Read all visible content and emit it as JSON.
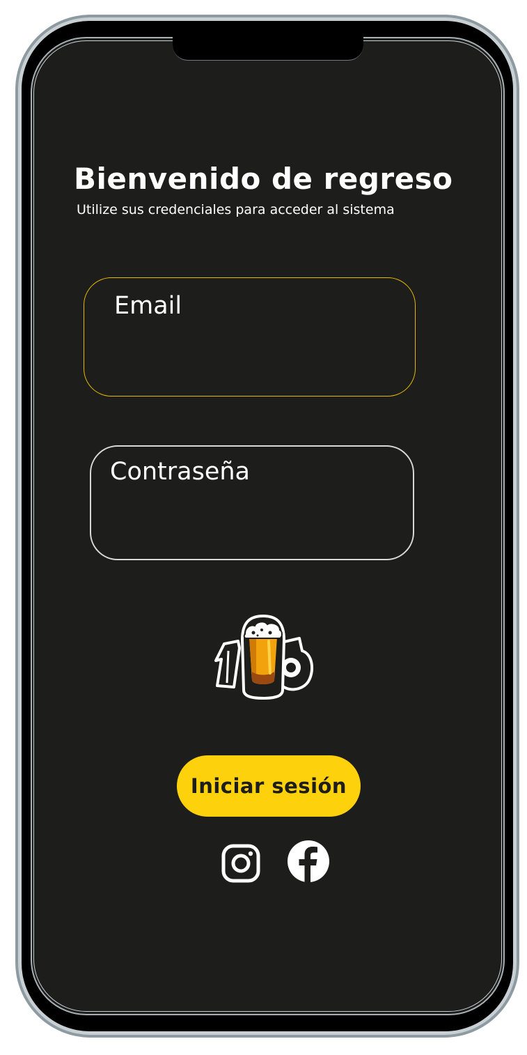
{
  "header": {
    "title": "Bienvenido de regreso",
    "subtitle": "Utilize sus credenciales para acceder al sistema"
  },
  "form": {
    "email": {
      "label": "Email",
      "value": "",
      "placeholder": ""
    },
    "password": {
      "label": "Contraseña",
      "value": "",
      "placeholder": ""
    },
    "submit_label": "Iniciar sesión"
  },
  "branding": {
    "logo_icon": "beer-mug-logo-icon"
  },
  "social": [
    {
      "icon": "instagram-icon"
    },
    {
      "icon": "facebook-icon"
    }
  ],
  "colors": {
    "background": "#1d1d1b",
    "accent": "#fdd10b",
    "email_border": "#e7b900",
    "password_border": "#d8d8d8",
    "text": "#ffffff"
  }
}
